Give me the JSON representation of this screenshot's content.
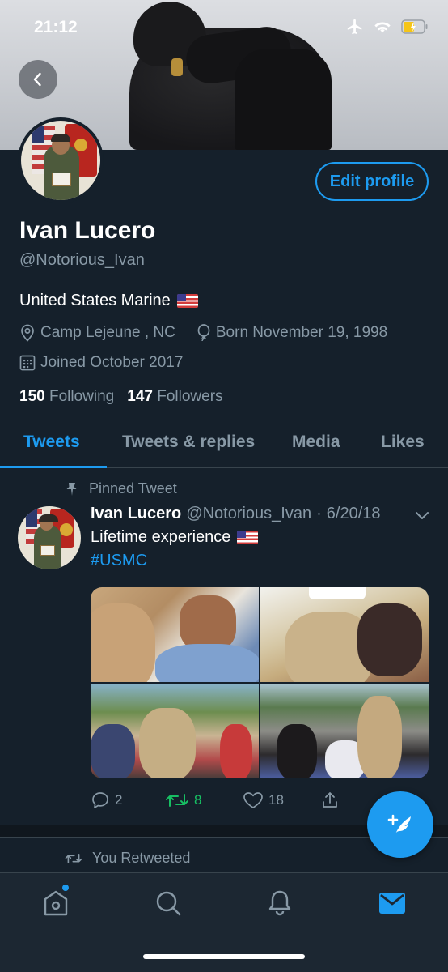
{
  "status_bar": {
    "time": "21:12"
  },
  "profile": {
    "edit_button_label": "Edit profile",
    "name": "Ivan Lucero",
    "handle": "@Notorious_Ivan",
    "bio": "United States Marine",
    "location": "Camp Lejeune , NC",
    "birthday": "Born November 19, 1998",
    "joined": "Joined October 2017",
    "following_count": "150",
    "following_label": "Following",
    "followers_count": "147",
    "followers_label": "Followers"
  },
  "tabs": [
    {
      "label": "Tweets",
      "active": true
    },
    {
      "label": "Tweets & replies",
      "active": false
    },
    {
      "label": "Media",
      "active": false
    },
    {
      "label": "Likes",
      "active": false
    }
  ],
  "pinned_tweet": {
    "pinned_label": "Pinned Tweet",
    "author_name": "Ivan Lucero",
    "author_handle": "@Notorious_Ivan",
    "separator": "·",
    "date": "6/20/18",
    "text": "Lifetime experience",
    "hashtag": "#USMC",
    "replies": "2",
    "retweets": "8",
    "likes": "18"
  },
  "next_item": {
    "retweeted_label": "You Retweeted"
  },
  "colors": {
    "background": "#15202b",
    "accent": "#1d9bf0",
    "retweet_green": "#17bf63",
    "secondary_text": "#8899a6"
  },
  "icons": [
    "back-arrow-icon",
    "airplane-icon",
    "wifi-icon",
    "battery-icon",
    "location-pin-icon",
    "balloon-icon",
    "calendar-icon",
    "pin-icon",
    "chevron-down-icon",
    "reply-icon",
    "retweet-icon",
    "like-icon",
    "share-icon",
    "compose-tweet-icon",
    "home-icon",
    "search-icon",
    "notifications-icon",
    "messages-icon"
  ]
}
